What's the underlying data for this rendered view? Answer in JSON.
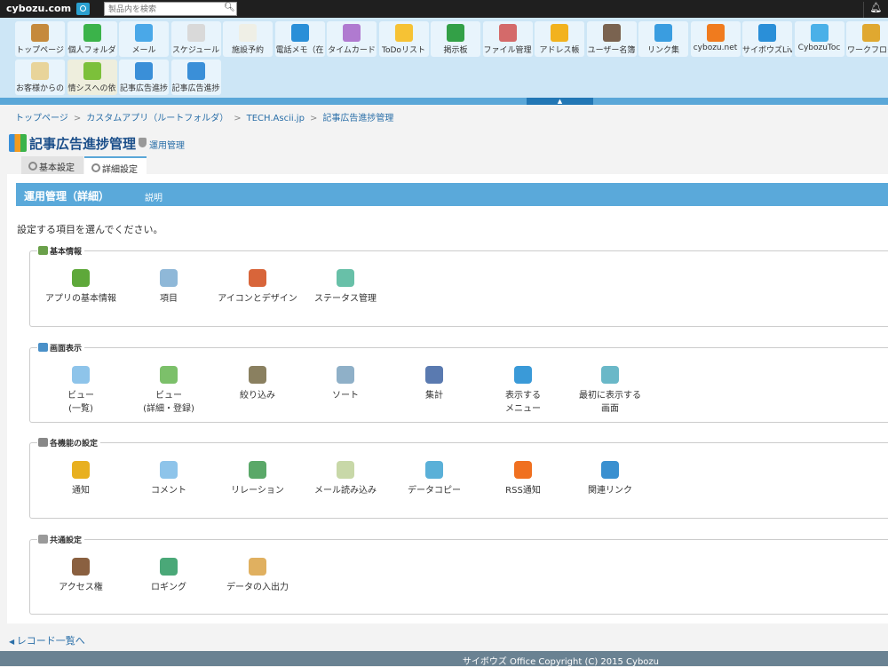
{
  "topbar": {
    "logo": "cybozu.com",
    "search_placeholder": "製品内を検索",
    "search_icon": "search-icon",
    "bell_icon": "bell-icon"
  },
  "apps": [
    {
      "label": "トップページ",
      "color": "#c58a3c"
    },
    {
      "label": "個人フォルダ",
      "color": "#3bb34a"
    },
    {
      "label": "メール",
      "color": "#4aa8e8"
    },
    {
      "label": "スケジュール",
      "color": "#d9d9d9"
    },
    {
      "label": "施設予約",
      "color": "#efefe6"
    },
    {
      "label": "電話メモ（在",
      "color": "#2a8fd8"
    },
    {
      "label": "タイムカード",
      "color": "#b07ad0"
    },
    {
      "label": "ToDoリスト",
      "color": "#f6c234"
    },
    {
      "label": "掲示板",
      "color": "#33a047"
    },
    {
      "label": "ファイル管理",
      "color": "#d46a6a"
    },
    {
      "label": "アドレス帳",
      "color": "#f2b21e"
    },
    {
      "label": "ユーザー名簿",
      "color": "#7a6350"
    },
    {
      "label": "リンク集",
      "color": "#3a9de0"
    },
    {
      "label": "cybozu.net",
      "color": "#f07b1e"
    },
    {
      "label": "サイボウズLiv",
      "color": "#2a8fd8"
    },
    {
      "label": "CybozuToc",
      "color": "#4ab0e8"
    },
    {
      "label": "ワークフロー",
      "color": "#e0a830"
    },
    {
      "label": "お客様からの",
      "color": "#e8d49a"
    },
    {
      "label": "情シスへの依",
      "color": "#7cc03a",
      "highlight": true
    },
    {
      "label": "記事広告進捗",
      "color": "#3a8fd8"
    },
    {
      "label": "記事広告進捗",
      "color": "#3a8fd8"
    }
  ],
  "strip_toggle": "▲",
  "breadcrumb": [
    "トップページ",
    "カスタムアプリ（ルートフォルダ）",
    "TECH.Ascii.jp",
    "記事広告進捗管理"
  ],
  "breadcrumb_sep": ">",
  "page_title": "記事広告進捗管理",
  "admin_link": "運用管理",
  "tabs": [
    {
      "label": "基本設定"
    },
    {
      "label": "詳細設定",
      "active": true
    }
  ],
  "section": {
    "title": "運用管理（詳細）",
    "desc": "説明"
  },
  "instruction": "設定する項目を選んでください。",
  "groups": [
    {
      "legend": "基本情報",
      "icon_color": "#6aa04a",
      "items": [
        {
          "label": "アプリの基本情報",
          "color": "#5ea83a"
        },
        {
          "label": "項目",
          "color": "#8fb8d8"
        },
        {
          "label": "アイコンとデザイン",
          "color": "#d8653a"
        },
        {
          "label": "ステータス管理",
          "color": "#68c0a8"
        }
      ]
    },
    {
      "legend": "画面表示",
      "icon_color": "#4a90c8",
      "items": [
        {
          "label": "ビュー\n(一覧)",
          "color": "#8ec4ea"
        },
        {
          "label": "ビュー\n(詳細・登録)",
          "color": "#7cc06a"
        },
        {
          "label": "絞り込み",
          "color": "#8a8060"
        },
        {
          "label": "ソート",
          "color": "#8fb0c8"
        },
        {
          "label": "集計",
          "color": "#5a7ab0"
        },
        {
          "label": "表示する\nメニュー",
          "color": "#3a9ad8"
        },
        {
          "label": "最初に表示する\n画面",
          "color": "#6ab8c8"
        }
      ]
    },
    {
      "legend": "各機能の設定",
      "icon_color": "#888888",
      "items": [
        {
          "label": "通知",
          "color": "#e8b020"
        },
        {
          "label": "コメント",
          "color": "#8ec4ea"
        },
        {
          "label": "リレーション",
          "color": "#5aa868"
        },
        {
          "label": "メール読み込み",
          "color": "#c8d8a8"
        },
        {
          "label": "データコピー",
          "color": "#5ab0d8"
        },
        {
          "label": "RSS通知",
          "color": "#f07020"
        },
        {
          "label": "関連リンク",
          "color": "#3a90d0"
        }
      ]
    },
    {
      "legend": "共通設定",
      "icon_color": "#9a9a9a",
      "items": [
        {
          "label": "アクセス権",
          "color": "#8a6040"
        },
        {
          "label": "ロギング",
          "color": "#4aa878"
        },
        {
          "label": "データの入出力",
          "color": "#e0b060"
        }
      ]
    }
  ],
  "back_link": "レコード一覧へ",
  "footer": "サイボウズ Office Copyright (C) 2015 Cybozu"
}
